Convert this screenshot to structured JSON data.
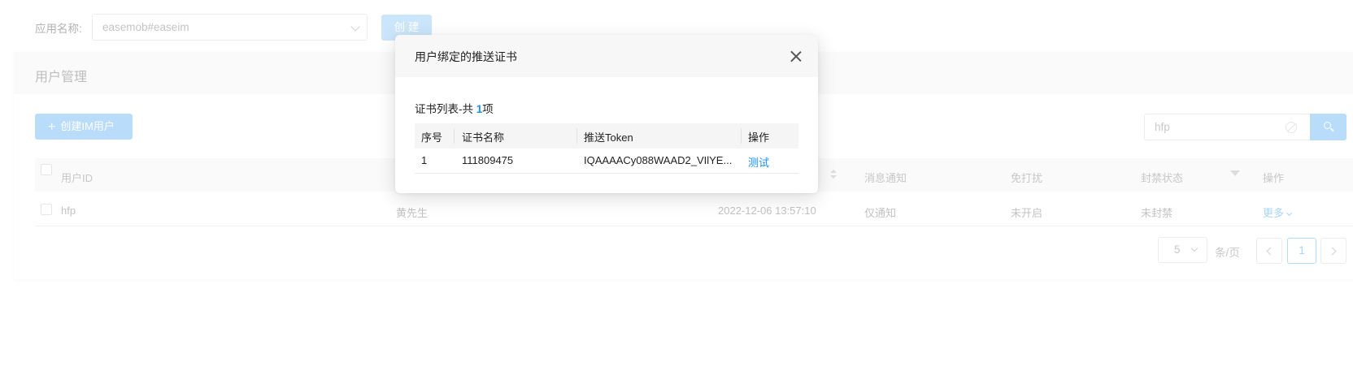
{
  "top_bar": {
    "app_label": "应用名称:",
    "app_value": "easemob#easeim",
    "create_label": "创 建"
  },
  "card": {
    "title": "用户管理",
    "add_user_label": "创建IM用户",
    "search_value": "hfp"
  },
  "table": {
    "columns": [
      "用户ID",
      "消息通知",
      "免打扰",
      "封禁状态",
      "操作"
    ],
    "rows": [
      {
        "user_id": "hfp",
        "nickname": "黄先生",
        "created": "2022-12-06 13:57:10",
        "notify": "仅通知",
        "dnd": "未开启",
        "ban": "未封禁",
        "action": "更多"
      }
    ]
  },
  "pagination": {
    "page_size": "5",
    "per_page_label": "条/页",
    "current_page": "1"
  },
  "modal": {
    "title": "用户绑定的推送证书",
    "summary_prefix": "证书列表-共 ",
    "summary_count": "1",
    "summary_suffix": "项",
    "columns": [
      "序号",
      "证书名称",
      "推送Token",
      "操作"
    ],
    "rows": [
      {
        "index": "1",
        "cert_name": "111809475",
        "token": "IQAAAACy088WAAD2_VIlYE...",
        "action": "测试"
      }
    ]
  },
  "colors": {
    "accent": "#1890ff",
    "accent_faded": "#b9dcfa"
  },
  "icons": [
    "chevron-down-icon",
    "plus-icon",
    "clear-icon",
    "search-icon",
    "sort-icon",
    "filter-icon",
    "chevron-left-icon",
    "chevron-right-icon",
    "close-icon"
  ]
}
